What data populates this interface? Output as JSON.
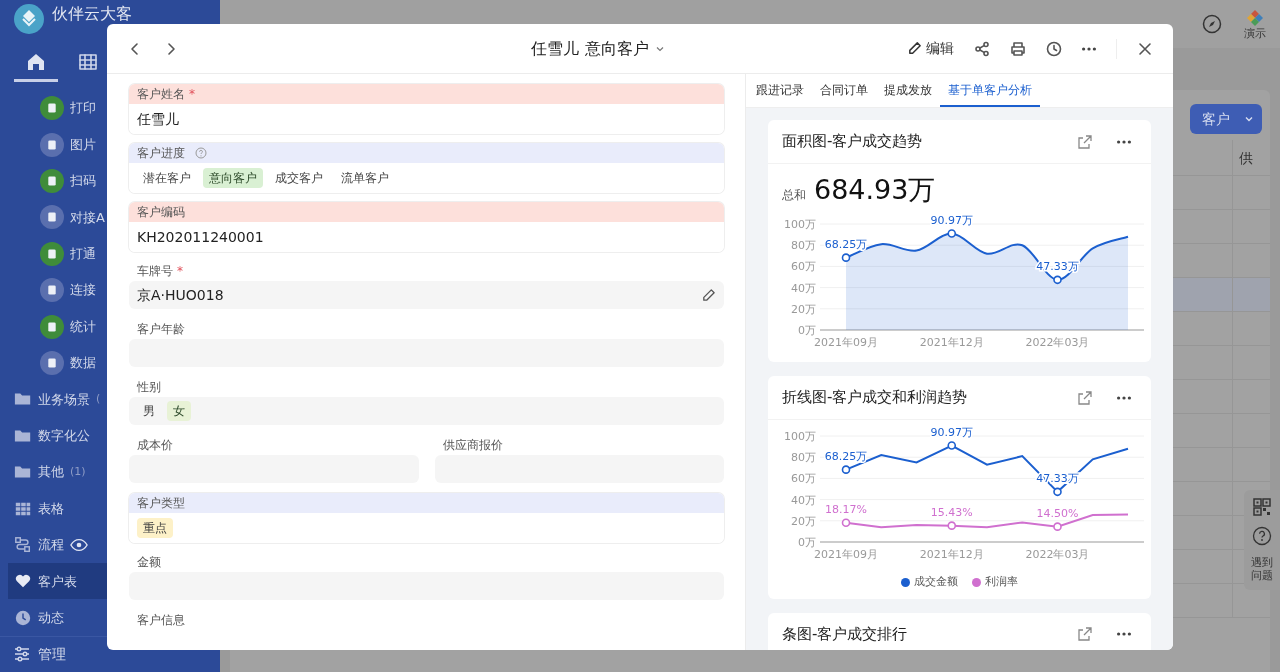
{
  "app": {
    "name": "伙伴云大客",
    "nav_tabs": [
      {
        "kind": "home",
        "selected": true
      },
      {
        "kind": "grid",
        "selected": false
      }
    ]
  },
  "sidebar": {
    "items": [
      {
        "label": "打印",
        "kind": "app",
        "color": "#3f8c3a",
        "selected": false,
        "watched": false
      },
      {
        "label": "图片",
        "kind": "app",
        "color": "#5a6fae",
        "selected": false,
        "watched": false
      },
      {
        "label": "扫码",
        "kind": "app",
        "color": "#3f8c3a",
        "selected": false,
        "watched": false
      },
      {
        "label": "对接A",
        "kind": "app",
        "color": "#5a6fae",
        "selected": false,
        "watched": false
      },
      {
        "label": "打通",
        "kind": "app",
        "color": "#3f8c3a",
        "selected": false,
        "watched": false
      },
      {
        "label": "连接",
        "kind": "app",
        "color": "#5a6fae",
        "selected": false,
        "watched": false
      },
      {
        "label": "统计",
        "kind": "app",
        "color": "#3f8c3a",
        "selected": false,
        "watched": false
      },
      {
        "label": "数据",
        "kind": "app",
        "color": "#5a6fae",
        "selected": false,
        "watched": false
      },
      {
        "label": "业务场景",
        "kind": "folder",
        "count": "(",
        "selected": false,
        "watched": false
      },
      {
        "label": "数字化公",
        "kind": "folder",
        "selected": false,
        "watched": false
      },
      {
        "label": "其他",
        "kind": "folder",
        "count": "(1)",
        "selected": false,
        "watched": false
      },
      {
        "label": "表格",
        "kind": "table",
        "selected": false,
        "watched": false
      },
      {
        "label": "流程",
        "kind": "workflow",
        "selected": false,
        "watched": true
      },
      {
        "label": "客户表",
        "kind": "favorite",
        "selected": true,
        "watched": false
      },
      {
        "label": "动态",
        "kind": "feed",
        "selected": false,
        "watched": false
      }
    ],
    "footer": {
      "label": "管理"
    }
  },
  "topbar": {
    "demo_label": "演示"
  },
  "toolbar": {
    "view_button": "客户"
  },
  "table": {
    "columns": [
      "供"
    ],
    "rows": [
      {
        "selected": false
      },
      {
        "selected": false
      },
      {
        "selected": false
      },
      {
        "selected": true
      },
      {
        "selected": false
      },
      {
        "selected": false
      },
      {
        "selected": false
      },
      {
        "selected": false
      },
      {
        "selected": false
      },
      {
        "selected": false
      },
      {
        "selected": false
      },
      {
        "selected": false
      },
      {
        "selected": false
      }
    ]
  },
  "help_panel": {
    "label": "遇到问题"
  },
  "record": {
    "title": "任雪儿 意向客户",
    "edit_label": "编辑",
    "fields": [
      {
        "kind": "text",
        "label": "客户姓名",
        "banded": true,
        "color": "#fde0db",
        "required_mark": "*",
        "value": "任雪儿"
      },
      {
        "kind": "choice",
        "label": "客户进度",
        "banded": true,
        "color": "#e9ecfb",
        "help": true,
        "options": [
          {
            "label": "潜在客户",
            "selected": false
          },
          {
            "label": "意向客户",
            "selected": true,
            "color": "#d9f0d3"
          },
          {
            "label": "成交客户",
            "selected": false
          },
          {
            "label": "流单客户",
            "selected": false
          }
        ]
      },
      {
        "kind": "text",
        "label": "客户编码",
        "banded": true,
        "color": "#fde0db",
        "value": "KH202011240001"
      },
      {
        "kind": "text",
        "label": "车牌号",
        "banded": false,
        "required_mark": "*",
        "edit_icon": true,
        "value": "京A·HUO018"
      },
      {
        "kind": "text",
        "label": "客户年龄",
        "banded": false
      },
      {
        "kind": "choice",
        "label": "性别",
        "banded": false,
        "options": [
          {
            "label": "男",
            "selected": false
          },
          {
            "label": "女",
            "selected": true,
            "color": "#e8f2d6"
          }
        ]
      },
      {
        "kind": "pair",
        "fields": [
          {
            "label": "成本价"
          },
          {
            "label": "供应商报价"
          }
        ]
      },
      {
        "kind": "tags",
        "label": "客户类型",
        "banded": true,
        "color": "#e9ecfb",
        "tags": [
          {
            "label": "重点",
            "color": "#fdf1c8"
          }
        ]
      },
      {
        "kind": "text",
        "label": "金额",
        "banded": false
      },
      {
        "kind": "label",
        "label": "客户信息"
      }
    ]
  },
  "side_panel": {
    "tabs": [
      {
        "label": "跟进记录",
        "selected": false
      },
      {
        "label": "合同订单",
        "selected": false
      },
      {
        "label": "提成发放",
        "selected": false
      },
      {
        "label": "基于单客户分析",
        "selected": true
      }
    ],
    "cards": [
      {
        "title": "面积图-客户成交趋势",
        "summary": {
          "label": "总和",
          "value": "684.93万"
        },
        "chart_data": {
          "type": "area",
          "categories": [
            "2021年09月",
            null,
            null,
            "2021年12月",
            null,
            null,
            "2022年03月",
            null,
            null
          ],
          "series": [
            {
              "color": "#1b5fcf",
              "values": [
                68.25,
                81,
                75,
                90.97,
                72,
                80,
                47.33,
                77,
                88
              ]
            }
          ],
          "ylim": [
            0,
            100
          ],
          "yticks": [
            {
              "value": 0,
              "label": "0万"
            },
            {
              "value": 20,
              "label": "20万"
            },
            {
              "value": 40,
              "label": "40万"
            },
            {
              "value": 60,
              "label": "60万"
            },
            {
              "value": 80,
              "label": "80万"
            },
            {
              "value": 100,
              "label": "100万"
            }
          ],
          "grid": true,
          "annotations": [
            {
              "x": "2021年09月",
              "y": 68.25,
              "text": "68.25万"
            },
            {
              "x": "2021年12月",
              "y": 90.97,
              "text": "90.97万"
            },
            {
              "x": "2022年03月",
              "y": 47.33,
              "text": "47.33万"
            }
          ]
        }
      },
      {
        "title": "折线图-客户成交和利润趋势",
        "chart_data": {
          "type": "line",
          "categories": [
            "2021年09月",
            null,
            null,
            "2021年12月",
            null,
            null,
            "2022年03月",
            null,
            null
          ],
          "series": [
            {
              "name": "成交金额",
              "color": "#1b5fcf",
              "values": [
                68.25,
                82,
                75,
                90.97,
                73,
                81,
                47.33,
                78,
                88
              ]
            },
            {
              "name": "利润率",
              "color": "#d070cf",
              "values": [
                18.17,
                14,
                16,
                15.43,
                14,
                18.5,
                14.5,
                25.5,
                26
              ]
            }
          ],
          "ylim": [
            0,
            100
          ],
          "yticks": [
            {
              "value": 0,
              "label": "0万"
            },
            {
              "value": 20,
              "label": "20万"
            },
            {
              "value": 40,
              "label": "40万"
            },
            {
              "value": 60,
              "label": "60万"
            },
            {
              "value": 80,
              "label": "80万"
            },
            {
              "value": 100,
              "label": "100万"
            }
          ],
          "grid": true,
          "annotations": [
            {
              "x": "2021年09月",
              "y": 68.25,
              "text": "68.25万"
            },
            {
              "x": "2021年12月",
              "y": 90.97,
              "text": "90.97万"
            },
            {
              "x": "2022年03月",
              "y": 47.33,
              "text": "47.33万"
            },
            {
              "x": "2021年09月",
              "y": 18.17,
              "text": "18.17%"
            },
            {
              "x": "2021年12月",
              "y": 15.43,
              "text": "15.43%"
            },
            {
              "x": "2022年03月",
              "y": 14.5,
              "text": "14.50%"
            }
          ]
        }
      },
      {
        "title": "条图-客户成交排行"
      }
    ]
  }
}
